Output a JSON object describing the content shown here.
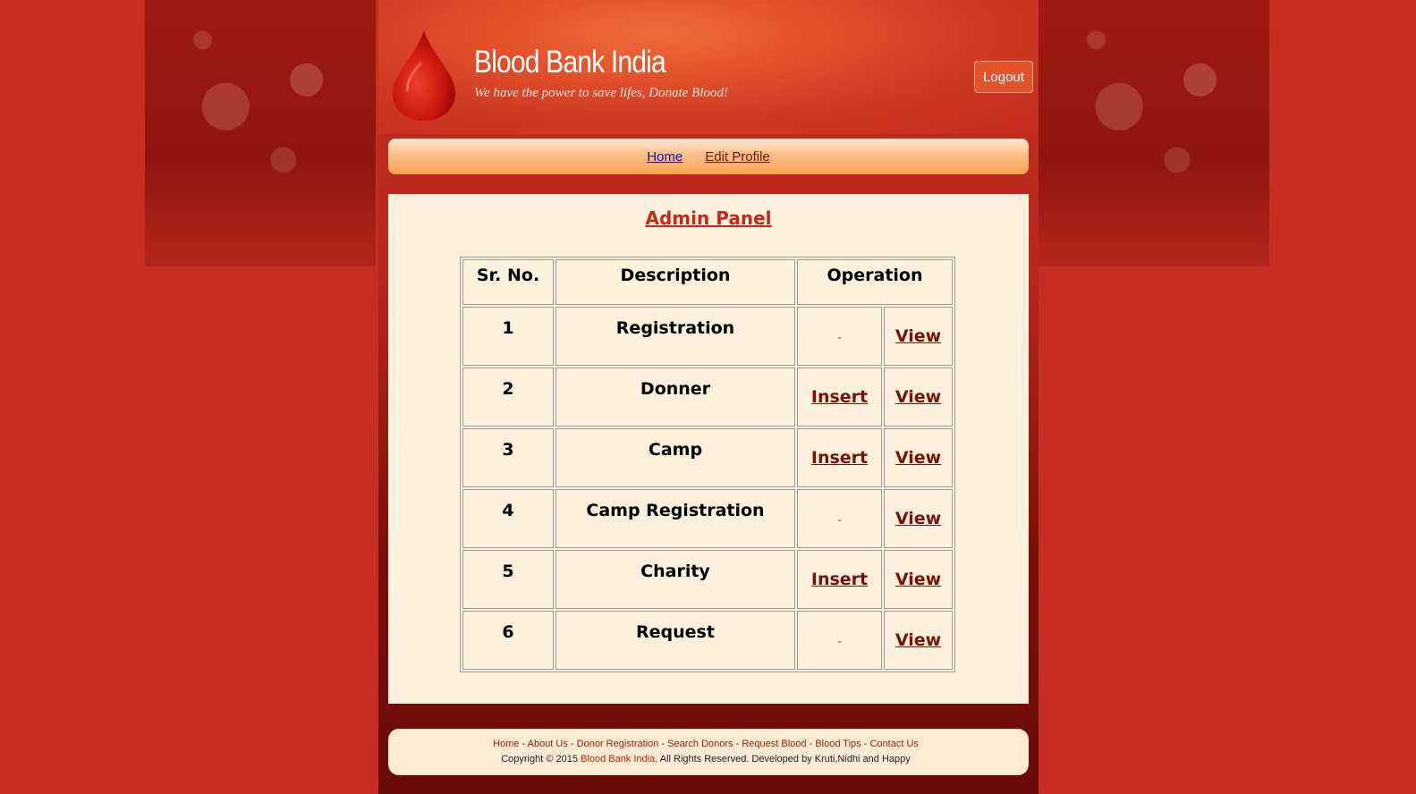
{
  "header": {
    "site_title": "Blood Bank India",
    "tagline": "We have the power to save lifes, Donate Blood!",
    "logout_label": "Logout"
  },
  "nav": {
    "items": [
      {
        "label": "Home"
      },
      {
        "label": "Edit Profile"
      }
    ]
  },
  "main": {
    "title": "Admin Panel",
    "table": {
      "headers": [
        "Sr. No.",
        "Description",
        "Operation"
      ],
      "rows": [
        {
          "sr": "1",
          "description": "Registration",
          "insert": "-",
          "view": "View"
        },
        {
          "sr": "2",
          "description": "Donner",
          "insert": "Insert",
          "view": "View"
        },
        {
          "sr": "3",
          "description": "Camp",
          "insert": "Insert",
          "view": "View"
        },
        {
          "sr": "4",
          "description": "Camp Registration",
          "insert": "-",
          "view": "View"
        },
        {
          "sr": "5",
          "description": "Charity",
          "insert": "Insert",
          "view": "View"
        },
        {
          "sr": "6",
          "description": "Request",
          "insert": "-",
          "view": "View"
        }
      ]
    }
  },
  "footer": {
    "links": [
      "Home",
      "About Us",
      "Donor Registration",
      "Search Donors",
      "Request Blood",
      "Blood Tips",
      "Contact Us"
    ],
    "link_separator": "-",
    "copyright_prefix": "Copyright © 2015",
    "brand": "Blood Bank India",
    "copyright_suffix": ". All Rights Reserved. Developed by Kruti,Nidhi and Happy"
  },
  "colors": {
    "background": "#c62e22",
    "content_bg": "#fdf0dd",
    "title_red": "#c12b1c",
    "link_maroon": "#7a1208",
    "nav_orange": "#f7a04e"
  }
}
